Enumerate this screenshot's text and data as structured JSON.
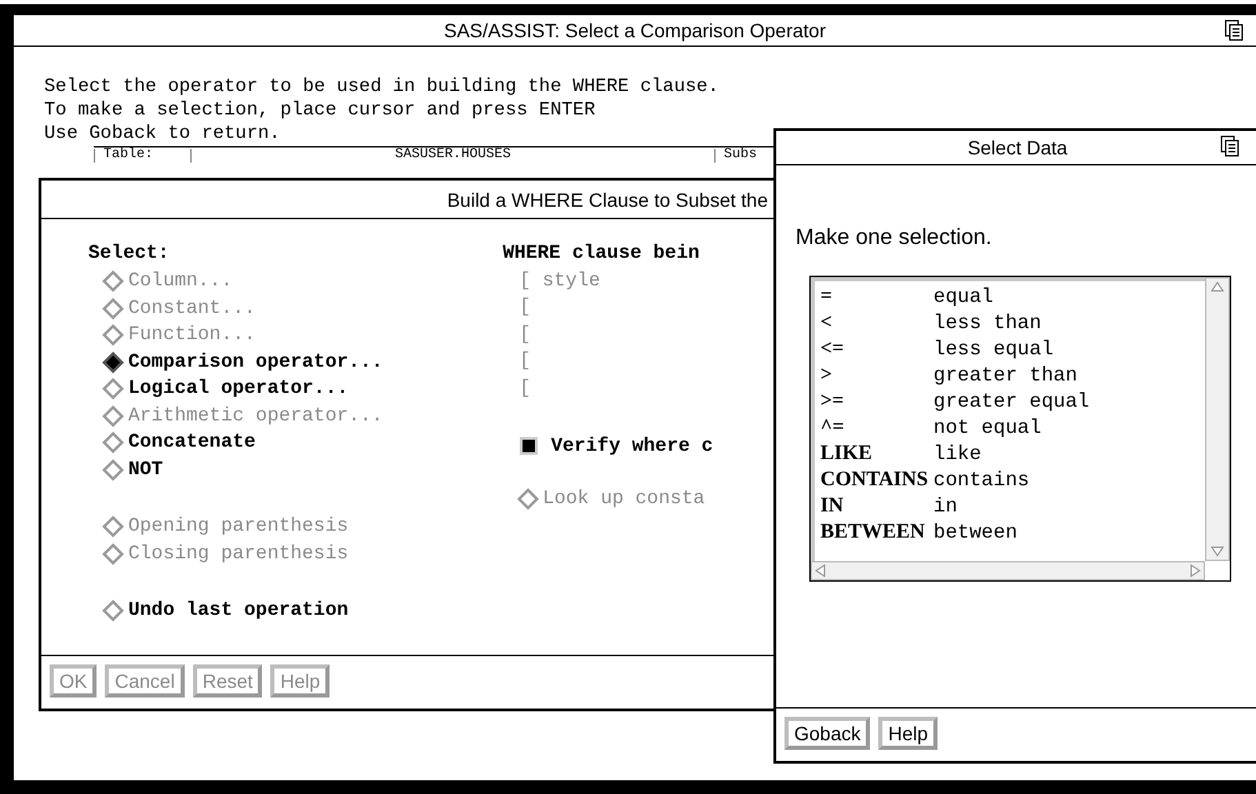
{
  "window": {
    "title": "SAS/ASSIST: Select a Comparison Operator"
  },
  "instructions": [
    "Select the operator to be used in building the WHERE clause.",
    "To make a selection, place cursor and press ENTER",
    "Use Goback to return."
  ],
  "table_strip": {
    "label": "Table:",
    "value": "SASUSER.HOUSES",
    "column_3": "Subs"
  },
  "build_dialog": {
    "title": "Build a WHERE Clause to Subset the",
    "select_label": "Select:",
    "option_groups": [
      [
        {
          "label": "Column...",
          "selected": false,
          "disabled": true
        },
        {
          "label": "Constant...",
          "selected": false,
          "disabled": true
        },
        {
          "label": "Function...",
          "selected": false,
          "disabled": true
        },
        {
          "label": "Comparison operator...",
          "selected": true,
          "disabled": false
        },
        {
          "label": "Logical operator...",
          "selected": false,
          "disabled": false
        },
        {
          "label": "Arithmetic operator...",
          "selected": false,
          "disabled": true
        },
        {
          "label": "Concatenate",
          "selected": false,
          "disabled": false
        },
        {
          "label": "NOT",
          "selected": false,
          "disabled": false
        }
      ],
      [
        {
          "label": "Opening parenthesis",
          "selected": false,
          "disabled": true
        },
        {
          "label": "Closing parenthesis",
          "selected": false,
          "disabled": true
        }
      ],
      [
        {
          "label": "Undo last operation",
          "selected": false,
          "disabled": false
        }
      ]
    ],
    "clause_label": "WHERE clause bein",
    "clause_lines": [
      "[ style",
      "[",
      "[",
      "[",
      "["
    ],
    "verify": {
      "label": "Verify where c",
      "checked": true
    },
    "lookup": {
      "label": "Look up consta",
      "selected": false,
      "disabled": true
    },
    "buttons": [
      {
        "label": "OK",
        "disabled": true
      },
      {
        "label": "Cancel",
        "disabled": true
      },
      {
        "label": "Reset",
        "disabled": true
      },
      {
        "label": "Help",
        "disabled": true
      }
    ]
  },
  "select_data": {
    "title": "Select Data",
    "prompt": "Make one selection.",
    "items": [
      {
        "operator": "=",
        "meaning": "equal",
        "selected": false
      },
      {
        "operator": "<",
        "meaning": "less than",
        "selected": false
      },
      {
        "operator": "<=",
        "meaning": "less equal",
        "selected": false
      },
      {
        "operator": ">",
        "meaning": "greater than",
        "selected": false
      },
      {
        "operator": ">=",
        "meaning": "greater equal",
        "selected": false
      },
      {
        "operator": "^=",
        "meaning": "not equal",
        "selected": false
      },
      {
        "operator": "LIKE",
        "meaning": "like",
        "selected": false
      },
      {
        "operator": "CONTAINS",
        "meaning": "contains",
        "selected": false
      },
      {
        "operator": "IN",
        "meaning": "in",
        "selected": false
      },
      {
        "operator": "BETWEEN",
        "meaning": "between",
        "selected": false
      }
    ],
    "buttons": [
      {
        "label": "Goback",
        "disabled": false
      },
      {
        "label": "Help",
        "disabled": false
      }
    ]
  }
}
